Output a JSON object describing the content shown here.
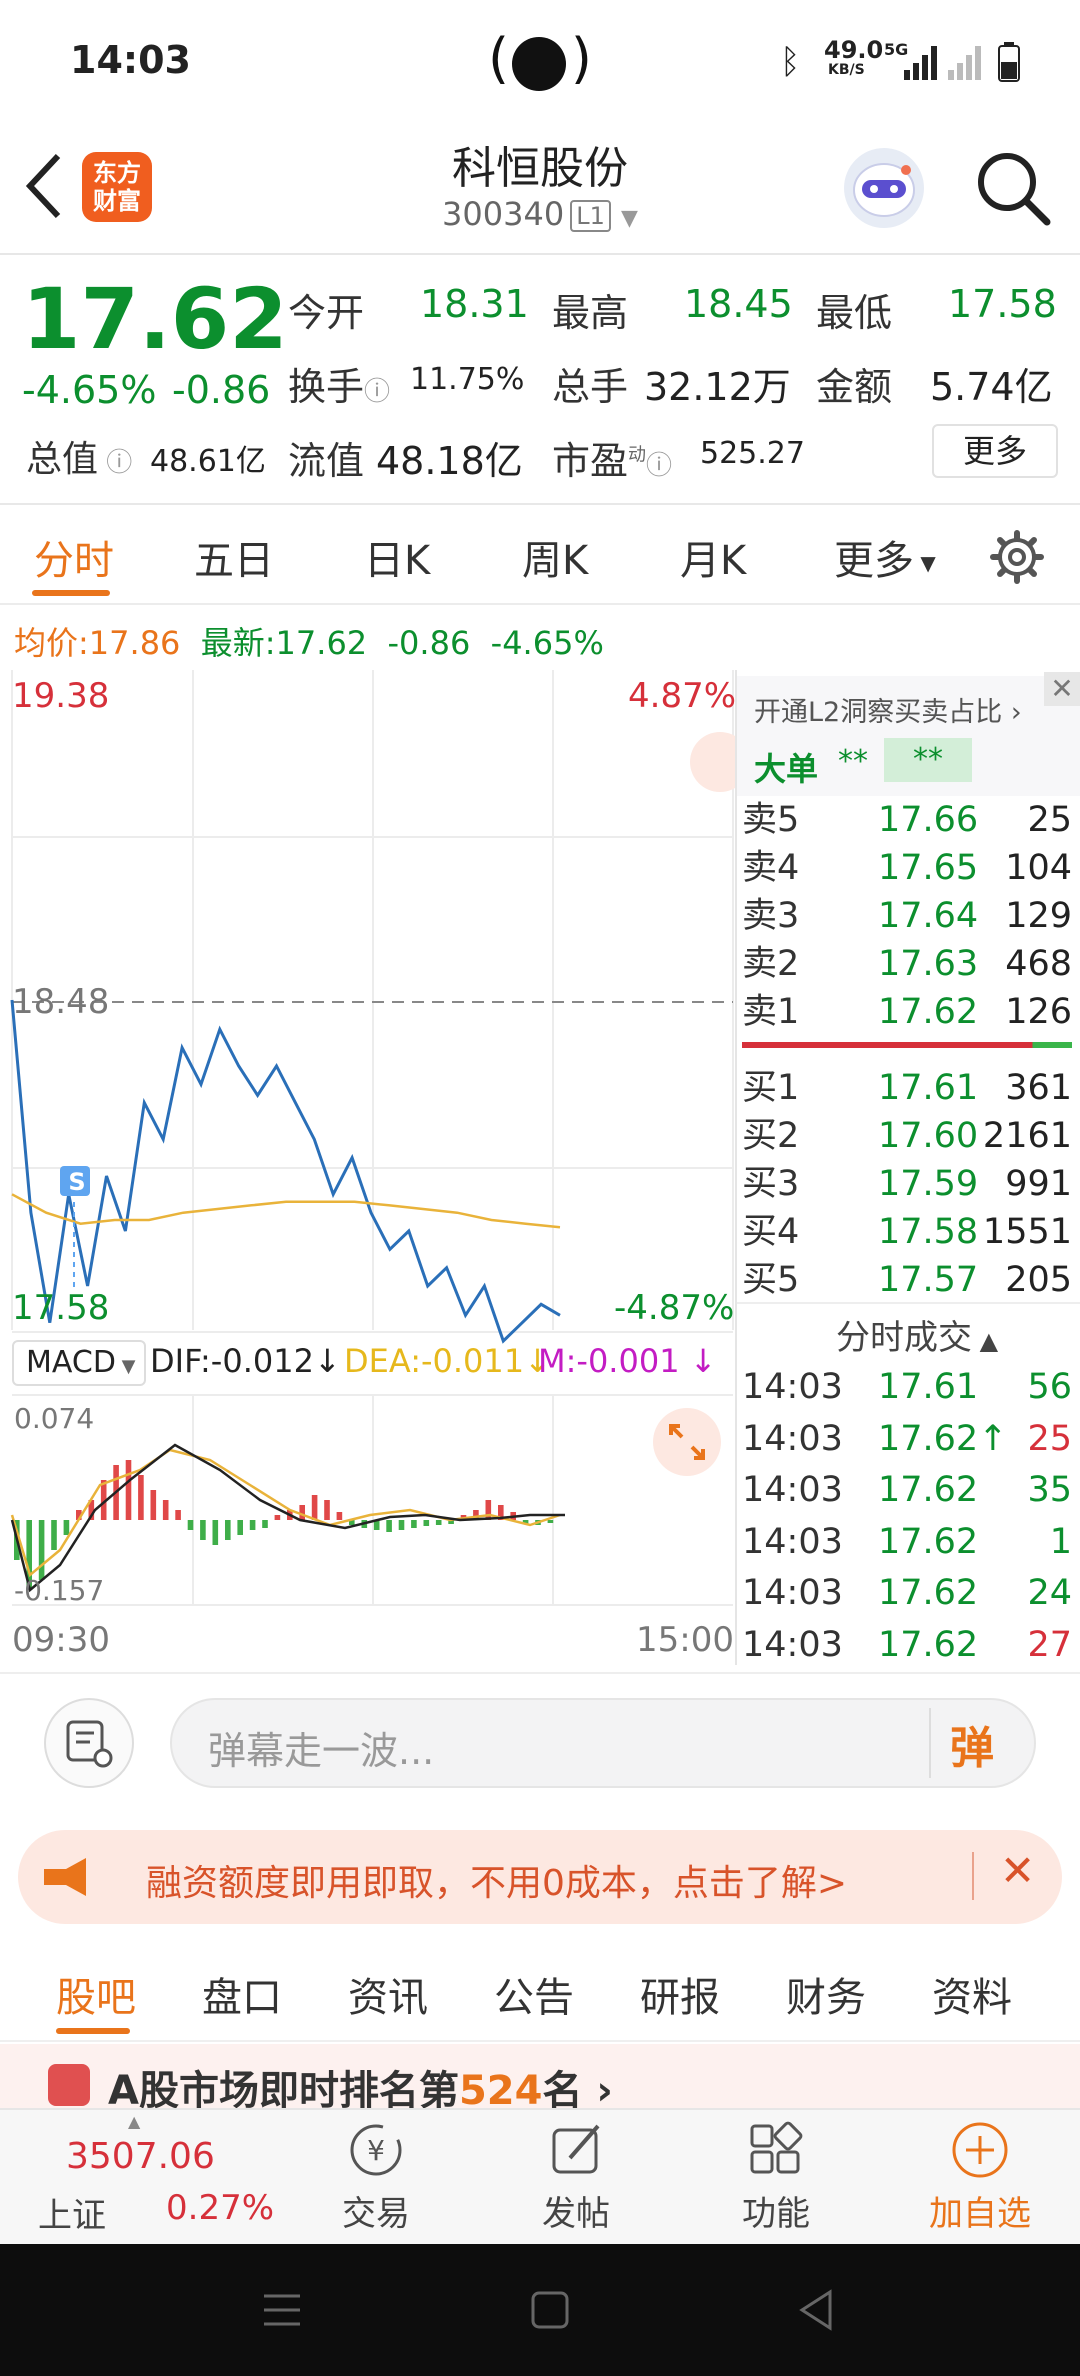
{
  "status_bar": {
    "time": "14:03",
    "network_speed": "49.0",
    "speed_unit": "KB/S",
    "network_type": "5G"
  },
  "header": {
    "logo_text_line1": "东方",
    "logo_text_line2": "财富",
    "stock_name": "科恒股份",
    "stock_code": "300340",
    "level_badge": "L1"
  },
  "quote": {
    "price": "17.62",
    "change_pct": "-4.65%",
    "change_amt": "-0.86",
    "open_label": "今开",
    "open": "18.31",
    "high_label": "最高",
    "high": "18.45",
    "low_label": "最低",
    "low": "17.58",
    "turnover_label": "换手",
    "turnover": "11.75%",
    "volume_label": "总手",
    "volume": "32.12万",
    "amount_label": "金额",
    "amount": "5.74亿",
    "mktcap_label": "总值",
    "mktcap": "48.61亿",
    "float_label": "流值",
    "float_cap": "48.18亿",
    "pe_label": "市盈",
    "pe_super": "动",
    "pe": "525.27",
    "more_button": "更多"
  },
  "tabs": [
    "分时",
    "五日",
    "日K",
    "周K",
    "月K",
    "更多"
  ],
  "info_line": {
    "avg_label": "均价:",
    "avg": "17.86",
    "latest_label": "最新:",
    "latest": "17.62",
    "chg": "-0.86",
    "pct": "-4.65%"
  },
  "chart": {
    "y_top": "19.38",
    "y_mid": "18.48",
    "y_bottom": "17.58",
    "pct_top": "4.87%",
    "pct_bottom": "-4.87%",
    "time_start": "09:30",
    "time_end": "15:00",
    "s_marker": "S",
    "macd_label": "MACD",
    "dif": "DIF:-0.012",
    "dea": "DEA:-0.011",
    "m": "M:-0.001",
    "macd_top": "0.074",
    "macd_bottom": "-0.157"
  },
  "chart_data": {
    "type": "line",
    "title": "",
    "xlabel": "",
    "ylabel": "",
    "x_range": [
      "09:30",
      "15:00"
    ],
    "ylim": [
      17.58,
      19.38
    ],
    "series": [
      {
        "name": "",
        "color": "#2a6fb8",
        "values": [
          18.48,
          17.9,
          17.6,
          17.95,
          17.7,
          18.0,
          17.85,
          18.2,
          18.1,
          18.35,
          18.25,
          18.4,
          18.3,
          18.22,
          18.3,
          18.2,
          18.1,
          17.95,
          18.05,
          17.9,
          17.8,
          17.85,
          17.7,
          17.75,
          17.62,
          17.7,
          17.55,
          17.6,
          17.65,
          17.62
        ]
      },
      {
        "name": "",
        "color": "#e9b33a",
        "values": [
          17.95,
          17.9,
          17.87,
          17.88,
          17.88,
          17.9,
          17.91,
          17.92,
          17.93,
          17.93,
          17.93,
          17.92,
          17.91,
          17.9,
          17.88,
          17.87,
          17.86
        ]
      }
    ]
  },
  "side_panel": {
    "l2_text": "开通L2洞察买卖占比",
    "big_order_label": "大单",
    "big_order_val1": "**",
    "big_order_val2": "**",
    "sells": [
      {
        "label": "卖5",
        "price": "17.66",
        "vol": "25"
      },
      {
        "label": "卖4",
        "price": "17.65",
        "vol": "104"
      },
      {
        "label": "卖3",
        "price": "17.64",
        "vol": "129"
      },
      {
        "label": "卖2",
        "price": "17.63",
        "vol": "468"
      },
      {
        "label": "卖1",
        "price": "17.62",
        "vol": "126"
      }
    ],
    "buys": [
      {
        "label": "买1",
        "price": "17.61",
        "vol": "361"
      },
      {
        "label": "买2",
        "price": "17.60",
        "vol": "2161"
      },
      {
        "label": "买3",
        "price": "17.59",
        "vol": "991"
      },
      {
        "label": "买4",
        "price": "17.58",
        "vol": "1551"
      },
      {
        "label": "买5",
        "price": "17.57",
        "vol": "205"
      }
    ],
    "trades_title": "分时成交",
    "trades": [
      {
        "time": "14:03",
        "price": "17.61",
        "vol": "56"
      },
      {
        "time": "14:03",
        "price": "17.62↑",
        "vol": "25"
      },
      {
        "time": "14:03",
        "price": "17.62",
        "vol": "35"
      },
      {
        "time": "14:03",
        "price": "17.62",
        "vol": "1"
      },
      {
        "time": "14:03",
        "price": "17.62",
        "vol": "24"
      },
      {
        "time": "14:03",
        "price": "17.62",
        "vol": "27"
      }
    ]
  },
  "danmu": {
    "placeholder": "弹幕走一波...",
    "button": "弹"
  },
  "banner": {
    "text": "融资额度即用即取，不用0成本，点击了解>"
  },
  "bottom_tabs": [
    "股吧",
    "盘口",
    "资讯",
    "公告",
    "研报",
    "财务",
    "资料"
  ],
  "news": {
    "text_prefix": "A股市场即时排名第",
    "rank": "524",
    "text_suffix": "名"
  },
  "bottom_bar": {
    "index_value": "3507.06",
    "index_name": "上证",
    "index_pct": "0.27%",
    "trade": "交易",
    "post": "发帖",
    "features": "功能",
    "add_watch": "加自选"
  }
}
